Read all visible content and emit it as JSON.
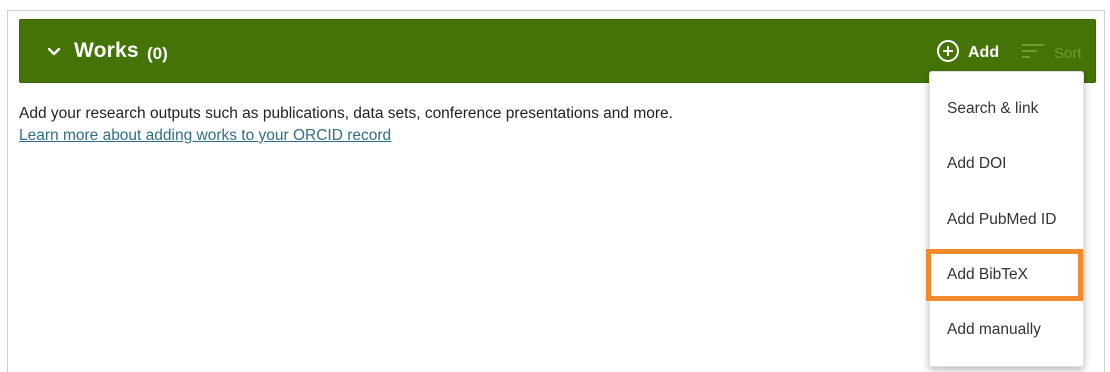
{
  "section": {
    "title": "Works",
    "count": "(0)",
    "add_label": "Add",
    "sort_label": "Sort"
  },
  "body": {
    "description": "Add your research outputs such as publications, data sets, conference presentations and more.",
    "learn_more": "Learn more about adding works to your ORCID record"
  },
  "add_menu": {
    "items": [
      {
        "label": "Search & link"
      },
      {
        "label": "Add DOI"
      },
      {
        "label": "Add PubMed ID"
      },
      {
        "label": "Add BibTeX",
        "highlighted": true
      },
      {
        "label": "Add manually"
      }
    ]
  },
  "colors": {
    "header_bg": "#447405",
    "highlight_outline": "#f08a2a",
    "link": "#2f6f86"
  },
  "icons": {
    "collapse": "chevron-down-icon",
    "add": "plus-circle-icon",
    "sort": "sort-lines-icon"
  }
}
